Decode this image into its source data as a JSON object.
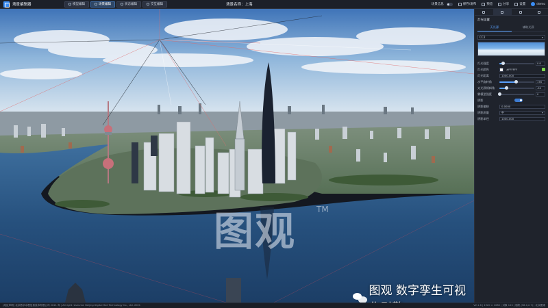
{
  "app": {
    "title": "场景编辑器",
    "scene_label": "场景名称：上海",
    "mode_tabs": [
      {
        "label": "模型编辑",
        "active": false
      },
      {
        "label": "场景编辑",
        "active": true
      },
      {
        "label": "状态编辑",
        "active": false
      },
      {
        "label": "交互编辑",
        "active": false
      }
    ],
    "scene_info_label": "场景信息",
    "actions": {
      "save": "保存/发布",
      "preview": "预览",
      "share": "分享",
      "settings": "设置"
    },
    "user": "demo"
  },
  "viewport": {
    "watermark": "图观",
    "watermark_tm": "TM",
    "brand_badge": "图观 数字孪生可视化引擎"
  },
  "panel": {
    "icon_tabs": [
      "camera-icon",
      "scene-icon",
      "brush-icon",
      "layers-icon"
    ],
    "section_title": "灯光设置",
    "subtabs": [
      "天光源",
      "辅助光源"
    ],
    "sky_select": "CC2",
    "rows": [
      {
        "label": "灯光强度",
        "type": "slider",
        "fill": 0.1,
        "value": "0.8"
      },
      {
        "label": "灯光颜色",
        "type": "color",
        "value": "#FFFFFF"
      },
      {
        "label": "灯光距离",
        "type": "input",
        "value": "1000.000"
      },
      {
        "label": "水平旋转角",
        "type": "slider",
        "fill": 0.48,
        "value": "178"
      },
      {
        "label": "太光源倾斜角",
        "type": "slider",
        "fill": 0.2,
        "value": "-30"
      },
      {
        "label": "雾模型强度",
        "type": "slider",
        "fill": 0.0,
        "value": "0"
      },
      {
        "label": "阴影",
        "type": "switch",
        "value": ""
      },
      {
        "label": "阴影偏移",
        "type": "input",
        "value": "0.0000"
      },
      {
        "label": "阴影质量",
        "type": "select",
        "value": "中"
      },
      {
        "label": "阴影半径",
        "type": "input",
        "value": "1000.000"
      }
    ]
  },
  "status": {
    "left": "[地区声明] 北京数字冰雹信息技术有限公司 2021 年 | All right reserved. Beijing Digital Hail Technology Co., Ltd. 2021",
    "right": "V2.1.6 | 1920 × 1080 | 对象 123 | 相机 (58.0,2.7) | 北京图观"
  }
}
